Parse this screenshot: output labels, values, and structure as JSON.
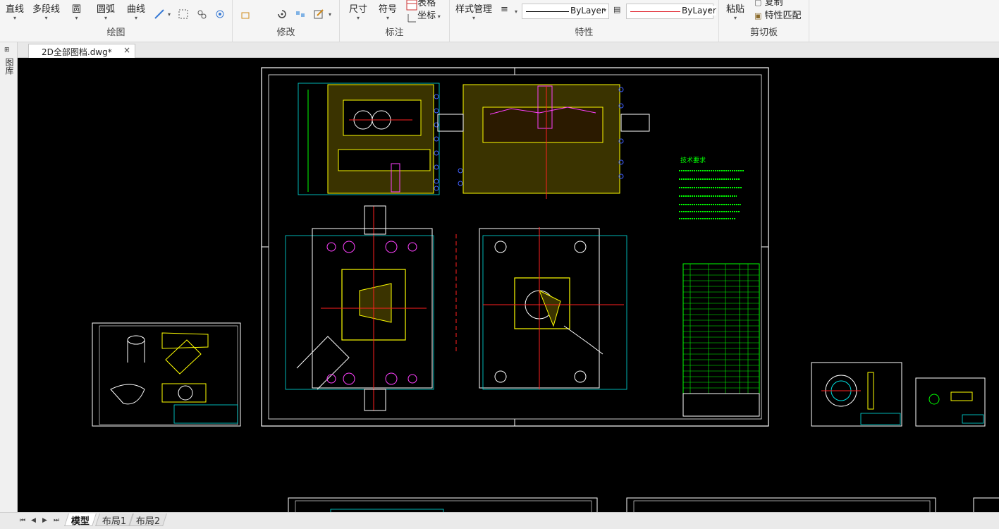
{
  "ribbon": {
    "draw_group": {
      "title": "绘图",
      "buttons": [
        "直线",
        "多段线",
        "圆",
        "圆弧",
        "曲线"
      ]
    },
    "modify_group": {
      "title": "修改"
    },
    "annotate_group": {
      "title": "标注",
      "dimension": "尺寸",
      "symbol": "符号",
      "table": "表格",
      "coordinate": "坐标"
    },
    "properties_group": {
      "title": "特性",
      "style_manager": "样式管理",
      "linetype_value": "ByLayer",
      "lineweight_value": "ByLayer",
      "linetype_sample_color": "#000000",
      "lineweight_sample_color": "#e0202a"
    },
    "clipboard_group": {
      "title": "剪切板",
      "paste": "粘贴",
      "copy": "复制",
      "match_props": "特性匹配"
    }
  },
  "document_tab": {
    "title": "2D全部图档.dwg*",
    "close": "×"
  },
  "left_panel": {
    "label": "图库"
  },
  "layout_tabs": [
    "模型",
    "布局1",
    "布局2"
  ],
  "active_layout": "模型",
  "drawing": {
    "tech_requirements_title": "技术要求",
    "tech_requirements_lines": [
      "1.",
      "2.",
      "3."
    ],
    "colors": {
      "background": "#000000",
      "frame": "#ffffff",
      "cyan": "#00e0e0",
      "yellow": "#ffff00",
      "green": "#00ff00",
      "red": "#ff2020",
      "magenta": "#ff40ff",
      "blue": "#4060ff"
    }
  }
}
